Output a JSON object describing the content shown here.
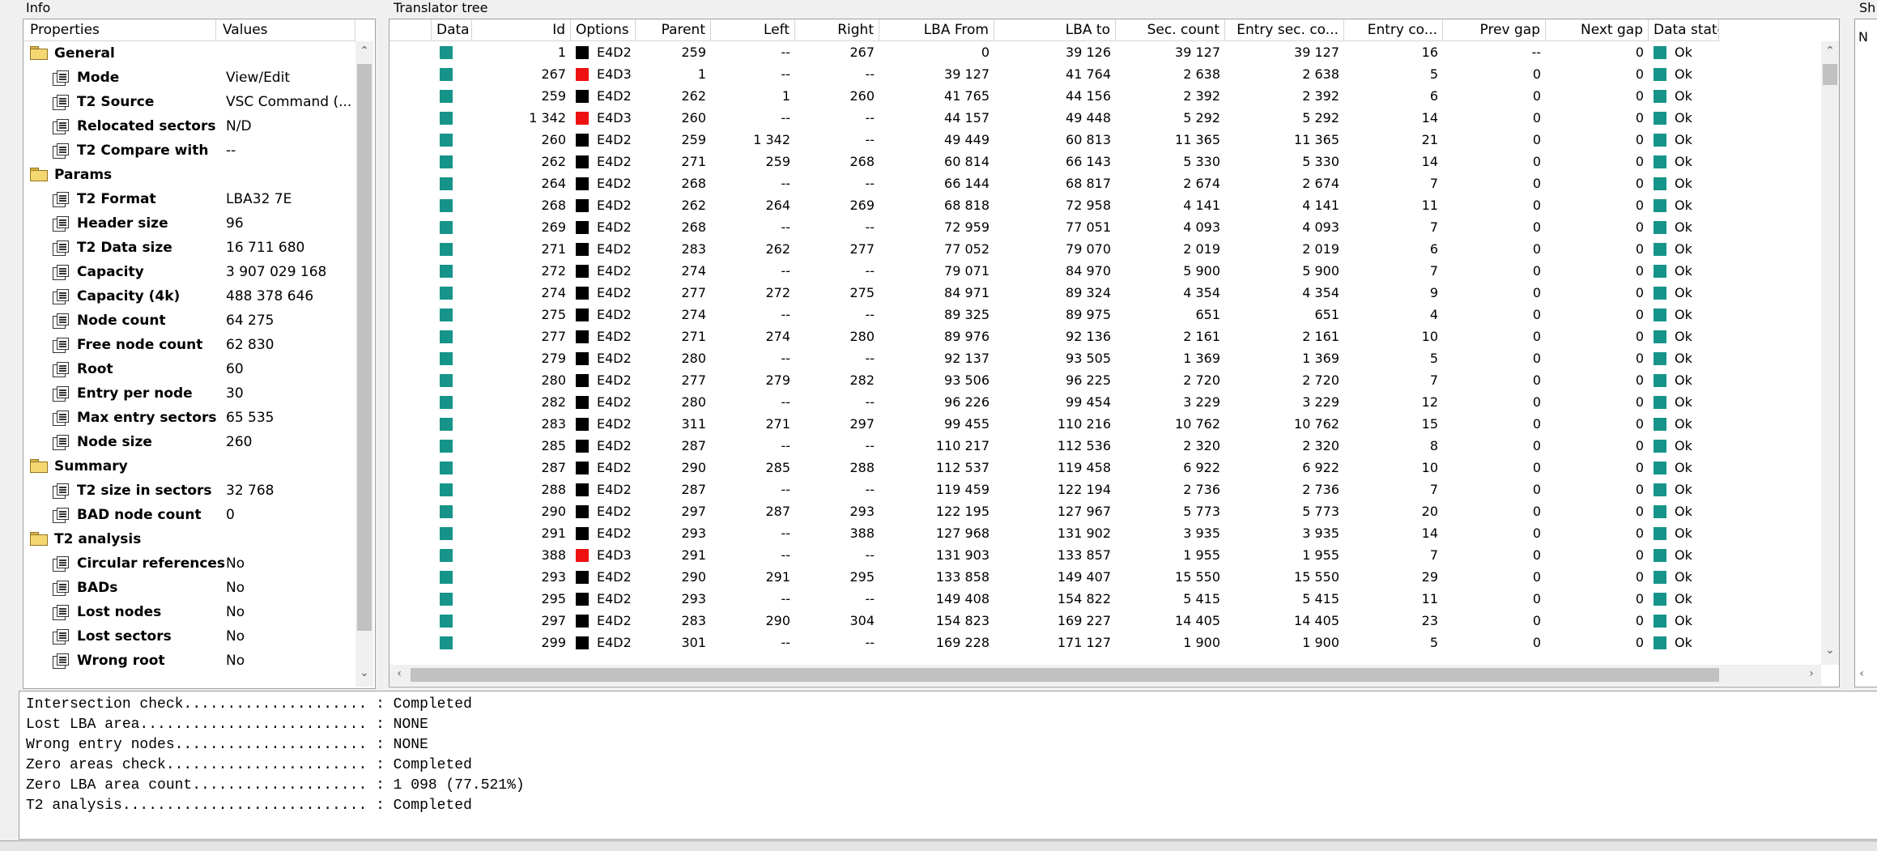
{
  "info_panel": {
    "title": "Info",
    "col_properties": "Properties",
    "col_values": "Values",
    "rows": [
      {
        "type": "group",
        "name": "General",
        "value": ""
      },
      {
        "type": "prop",
        "name": "Mode",
        "value": "View/Edit"
      },
      {
        "type": "prop",
        "name": "T2 Source",
        "value": "VSC Command (..."
      },
      {
        "type": "prop",
        "name": "Relocated sectors",
        "value": "N/D"
      },
      {
        "type": "prop",
        "name": "T2 Compare with",
        "value": "--"
      },
      {
        "type": "group",
        "name": "Params",
        "value": ""
      },
      {
        "type": "prop",
        "name": "T2 Format",
        "value": "LBA32 7E"
      },
      {
        "type": "prop",
        "name": "Header size",
        "value": "96"
      },
      {
        "type": "prop",
        "name": "T2 Data size",
        "value": "16 711 680"
      },
      {
        "type": "prop",
        "name": "Capacity",
        "value": "3 907 029 168"
      },
      {
        "type": "prop",
        "name": "Capacity (4k)",
        "value": "488 378 646"
      },
      {
        "type": "prop",
        "name": "Node count",
        "value": "64 275"
      },
      {
        "type": "prop",
        "name": "Free node count",
        "value": "62 830"
      },
      {
        "type": "prop",
        "name": "Root",
        "value": "60"
      },
      {
        "type": "prop",
        "name": "Entry per node",
        "value": "30"
      },
      {
        "type": "prop",
        "name": "Max entry sectors",
        "value": "65 535"
      },
      {
        "type": "prop",
        "name": "Node size",
        "value": "260"
      },
      {
        "type": "group",
        "name": "Summary",
        "value": ""
      },
      {
        "type": "prop",
        "name": "T2 size in sectors",
        "value": "32 768"
      },
      {
        "type": "prop",
        "name": "BAD node count",
        "value": "0"
      },
      {
        "type": "group",
        "name": "T2 analysis",
        "value": ""
      },
      {
        "type": "prop",
        "name": "Circular references",
        "value": "No"
      },
      {
        "type": "prop",
        "name": "BADs",
        "value": "No"
      },
      {
        "type": "prop",
        "name": "Lost nodes",
        "value": "No"
      },
      {
        "type": "prop",
        "name": "Lost sectors",
        "value": "No"
      },
      {
        "type": "prop",
        "name": "Wrong root",
        "value": "No"
      }
    ]
  },
  "tree_panel": {
    "title": "Translator tree",
    "columns": [
      "Data",
      "Id",
      "Options",
      "Parent",
      "Left",
      "Right",
      "LBA From",
      "LBA to",
      "Sec. count",
      "Entry sec. co...",
      "Entry co...",
      "Prev gap",
      "Next gap",
      "Data state"
    ],
    "rows": [
      {
        "id": "1",
        "opt": "E4D2",
        "red": false,
        "parent": "259",
        "left": "--",
        "right": "267",
        "from": "0",
        "to": "39 126",
        "sec": "39 127",
        "esec": "39 127",
        "ecount": "16",
        "prev": "--",
        "next": "0",
        "state": "Ok"
      },
      {
        "id": "267",
        "opt": "E4D3",
        "red": true,
        "parent": "1",
        "left": "--",
        "right": "--",
        "from": "39 127",
        "to": "41 764",
        "sec": "2 638",
        "esec": "2 638",
        "ecount": "5",
        "prev": "0",
        "next": "0",
        "state": "Ok"
      },
      {
        "id": "259",
        "opt": "E4D2",
        "red": false,
        "parent": "262",
        "left": "1",
        "right": "260",
        "from": "41 765",
        "to": "44 156",
        "sec": "2 392",
        "esec": "2 392",
        "ecount": "6",
        "prev": "0",
        "next": "0",
        "state": "Ok"
      },
      {
        "id": "1 342",
        "opt": "E4D3",
        "red": true,
        "parent": "260",
        "left": "--",
        "right": "--",
        "from": "44 157",
        "to": "49 448",
        "sec": "5 292",
        "esec": "5 292",
        "ecount": "14",
        "prev": "0",
        "next": "0",
        "state": "Ok"
      },
      {
        "id": "260",
        "opt": "E4D2",
        "red": false,
        "parent": "259",
        "left": "1 342",
        "right": "--",
        "from": "49 449",
        "to": "60 813",
        "sec": "11 365",
        "esec": "11 365",
        "ecount": "21",
        "prev": "0",
        "next": "0",
        "state": "Ok"
      },
      {
        "id": "262",
        "opt": "E4D2",
        "red": false,
        "parent": "271",
        "left": "259",
        "right": "268",
        "from": "60 814",
        "to": "66 143",
        "sec": "5 330",
        "esec": "5 330",
        "ecount": "14",
        "prev": "0",
        "next": "0",
        "state": "Ok"
      },
      {
        "id": "264",
        "opt": "E4D2",
        "red": false,
        "parent": "268",
        "left": "--",
        "right": "--",
        "from": "66 144",
        "to": "68 817",
        "sec": "2 674",
        "esec": "2 674",
        "ecount": "7",
        "prev": "0",
        "next": "0",
        "state": "Ok"
      },
      {
        "id": "268",
        "opt": "E4D2",
        "red": false,
        "parent": "262",
        "left": "264",
        "right": "269",
        "from": "68 818",
        "to": "72 958",
        "sec": "4 141",
        "esec": "4 141",
        "ecount": "11",
        "prev": "0",
        "next": "0",
        "state": "Ok"
      },
      {
        "id": "269",
        "opt": "E4D2",
        "red": false,
        "parent": "268",
        "left": "--",
        "right": "--",
        "from": "72 959",
        "to": "77 051",
        "sec": "4 093",
        "esec": "4 093",
        "ecount": "7",
        "prev": "0",
        "next": "0",
        "state": "Ok"
      },
      {
        "id": "271",
        "opt": "E4D2",
        "red": false,
        "parent": "283",
        "left": "262",
        "right": "277",
        "from": "77 052",
        "to": "79 070",
        "sec": "2 019",
        "esec": "2 019",
        "ecount": "6",
        "prev": "0",
        "next": "0",
        "state": "Ok"
      },
      {
        "id": "272",
        "opt": "E4D2",
        "red": false,
        "parent": "274",
        "left": "--",
        "right": "--",
        "from": "79 071",
        "to": "84 970",
        "sec": "5 900",
        "esec": "5 900",
        "ecount": "7",
        "prev": "0",
        "next": "0",
        "state": "Ok"
      },
      {
        "id": "274",
        "opt": "E4D2",
        "red": false,
        "parent": "277",
        "left": "272",
        "right": "275",
        "from": "84 971",
        "to": "89 324",
        "sec": "4 354",
        "esec": "4 354",
        "ecount": "9",
        "prev": "0",
        "next": "0",
        "state": "Ok"
      },
      {
        "id": "275",
        "opt": "E4D2",
        "red": false,
        "parent": "274",
        "left": "--",
        "right": "--",
        "from": "89 325",
        "to": "89 975",
        "sec": "651",
        "esec": "651",
        "ecount": "4",
        "prev": "0",
        "next": "0",
        "state": "Ok"
      },
      {
        "id": "277",
        "opt": "E4D2",
        "red": false,
        "parent": "271",
        "left": "274",
        "right": "280",
        "from": "89 976",
        "to": "92 136",
        "sec": "2 161",
        "esec": "2 161",
        "ecount": "10",
        "prev": "0",
        "next": "0",
        "state": "Ok"
      },
      {
        "id": "279",
        "opt": "E4D2",
        "red": false,
        "parent": "280",
        "left": "--",
        "right": "--",
        "from": "92 137",
        "to": "93 505",
        "sec": "1 369",
        "esec": "1 369",
        "ecount": "5",
        "prev": "0",
        "next": "0",
        "state": "Ok"
      },
      {
        "id": "280",
        "opt": "E4D2",
        "red": false,
        "parent": "277",
        "left": "279",
        "right": "282",
        "from": "93 506",
        "to": "96 225",
        "sec": "2 720",
        "esec": "2 720",
        "ecount": "7",
        "prev": "0",
        "next": "0",
        "state": "Ok"
      },
      {
        "id": "282",
        "opt": "E4D2",
        "red": false,
        "parent": "280",
        "left": "--",
        "right": "--",
        "from": "96 226",
        "to": "99 454",
        "sec": "3 229",
        "esec": "3 229",
        "ecount": "12",
        "prev": "0",
        "next": "0",
        "state": "Ok"
      },
      {
        "id": "283",
        "opt": "E4D2",
        "red": false,
        "parent": "311",
        "left": "271",
        "right": "297",
        "from": "99 455",
        "to": "110 216",
        "sec": "10 762",
        "esec": "10 762",
        "ecount": "15",
        "prev": "0",
        "next": "0",
        "state": "Ok"
      },
      {
        "id": "285",
        "opt": "E4D2",
        "red": false,
        "parent": "287",
        "left": "--",
        "right": "--",
        "from": "110 217",
        "to": "112 536",
        "sec": "2 320",
        "esec": "2 320",
        "ecount": "8",
        "prev": "0",
        "next": "0",
        "state": "Ok"
      },
      {
        "id": "287",
        "opt": "E4D2",
        "red": false,
        "parent": "290",
        "left": "285",
        "right": "288",
        "from": "112 537",
        "to": "119 458",
        "sec": "6 922",
        "esec": "6 922",
        "ecount": "10",
        "prev": "0",
        "next": "0",
        "state": "Ok"
      },
      {
        "id": "288",
        "opt": "E4D2",
        "red": false,
        "parent": "287",
        "left": "--",
        "right": "--",
        "from": "119 459",
        "to": "122 194",
        "sec": "2 736",
        "esec": "2 736",
        "ecount": "7",
        "prev": "0",
        "next": "0",
        "state": "Ok"
      },
      {
        "id": "290",
        "opt": "E4D2",
        "red": false,
        "parent": "297",
        "left": "287",
        "right": "293",
        "from": "122 195",
        "to": "127 967",
        "sec": "5 773",
        "esec": "5 773",
        "ecount": "20",
        "prev": "0",
        "next": "0",
        "state": "Ok"
      },
      {
        "id": "291",
        "opt": "E4D2",
        "red": false,
        "parent": "293",
        "left": "--",
        "right": "388",
        "from": "127 968",
        "to": "131 902",
        "sec": "3 935",
        "esec": "3 935",
        "ecount": "14",
        "prev": "0",
        "next": "0",
        "state": "Ok"
      },
      {
        "id": "388",
        "opt": "E4D3",
        "red": true,
        "parent": "291",
        "left": "--",
        "right": "--",
        "from": "131 903",
        "to": "133 857",
        "sec": "1 955",
        "esec": "1 955",
        "ecount": "7",
        "prev": "0",
        "next": "0",
        "state": "Ok"
      },
      {
        "id": "293",
        "opt": "E4D2",
        "red": false,
        "parent": "290",
        "left": "291",
        "right": "295",
        "from": "133 858",
        "to": "149 407",
        "sec": "15 550",
        "esec": "15 550",
        "ecount": "29",
        "prev": "0",
        "next": "0",
        "state": "Ok"
      },
      {
        "id": "295",
        "opt": "E4D2",
        "red": false,
        "parent": "293",
        "left": "--",
        "right": "--",
        "from": "149 408",
        "to": "154 822",
        "sec": "5 415",
        "esec": "5 415",
        "ecount": "11",
        "prev": "0",
        "next": "0",
        "state": "Ok"
      },
      {
        "id": "297",
        "opt": "E4D2",
        "red": false,
        "parent": "283",
        "left": "290",
        "right": "304",
        "from": "154 823",
        "to": "169 227",
        "sec": "14 405",
        "esec": "14 405",
        "ecount": "23",
        "prev": "0",
        "next": "0",
        "state": "Ok"
      },
      {
        "id": "299",
        "opt": "E4D2",
        "red": false,
        "parent": "301",
        "left": "--",
        "right": "--",
        "from": "169 228",
        "to": "171 127",
        "sec": "1 900",
        "esec": "1 900",
        "ecount": "5",
        "prev": "0",
        "next": "0",
        "state": "Ok"
      }
    ]
  },
  "side_panel_label": "Sh",
  "side_panel_value": "N",
  "log_lines": [
    "Intersection check..................... : Completed",
    "Lost LBA area.......................... : NONE",
    "Wrong entry nodes...................... : NONE",
    "Zero areas check....................... : Completed",
    "Zero LBA area count.................... : 1 098 (77.521%)",
    "T2 analysis............................ : Completed"
  ],
  "colors": {
    "data_teal": "#16948a",
    "opt_black": "#000000",
    "opt_red": "#ee1111"
  }
}
